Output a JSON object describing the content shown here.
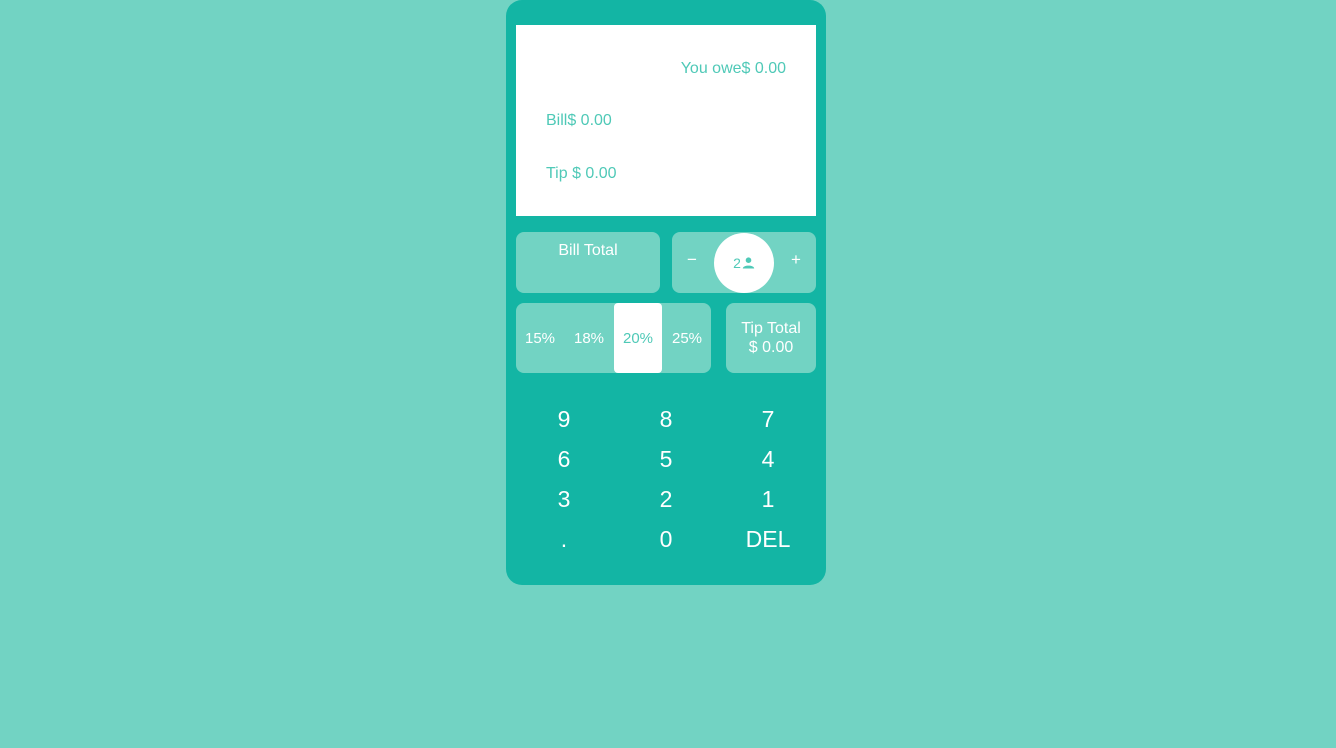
{
  "display": {
    "you_owe": "You owe$ 0.00",
    "bill": "Bill$ 0.00",
    "tip": "Tip $ 0.00"
  },
  "bill_total": {
    "label": "Bill Total"
  },
  "people": {
    "minus_label": "−",
    "plus_label": "+",
    "count": "2",
    "icon": "person-icon"
  },
  "tip_options": [
    {
      "label": "15%"
    },
    {
      "label": "18%"
    },
    {
      "label": "20%",
      "selected": true
    },
    {
      "label": "25%"
    }
  ],
  "tip_total": {
    "label": "Tip Total",
    "value": "$ 0.00"
  },
  "keypad": {
    "keys": [
      "9",
      "8",
      "7",
      "6",
      "5",
      "4",
      "3",
      "2",
      "1",
      ".",
      "0",
      "DEL"
    ]
  },
  "colors": {
    "background": "#72d3c3",
    "calculator": "#13b5a4",
    "text_accent": "#4fc9b7"
  }
}
